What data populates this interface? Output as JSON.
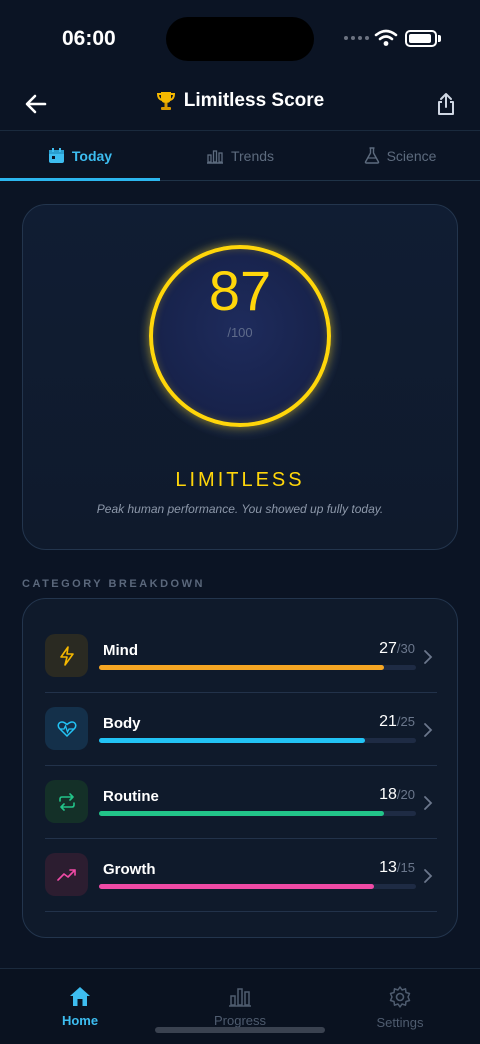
{
  "status": {
    "time": "06:00"
  },
  "header": {
    "title": "Limitless Score",
    "title_icon": "trophy-icon"
  },
  "tabs": [
    {
      "label": "Today",
      "icon": "calendar-icon",
      "active": true
    },
    {
      "label": "Trends",
      "icon": "bar-chart-icon",
      "active": false
    },
    {
      "label": "Science",
      "icon": "flask-icon",
      "active": false
    }
  ],
  "score": {
    "value": "87",
    "max": "/100",
    "progress": 0.87,
    "tier": "LIMITLESS",
    "description": "Peak human performance. You showed up fully today.",
    "accent": "#ffd60a"
  },
  "breakdown": {
    "label": "CATEGORY BREAKDOWN",
    "categories": [
      {
        "name": "Mind",
        "score": "27",
        "max": "/30",
        "fraction": 0.9,
        "color": "#f5a623",
        "icon": "lightning-icon"
      },
      {
        "name": "Body",
        "score": "21",
        "max": "/25",
        "fraction": 0.84,
        "color": "#22c3f5",
        "icon": "heart-pulse-icon"
      },
      {
        "name": "Routine",
        "score": "18",
        "max": "/20",
        "fraction": 0.9,
        "color": "#22c489",
        "icon": "repeat-icon"
      },
      {
        "name": "Growth",
        "score": "13",
        "max": "/15",
        "fraction": 0.867,
        "color": "#f04aa5",
        "icon": "trend-up-icon"
      }
    ]
  },
  "bottom_nav": [
    {
      "label": "Home",
      "icon": "home-icon",
      "active": true
    },
    {
      "label": "Progress",
      "icon": "bar-chart-icon",
      "active": false
    },
    {
      "label": "Settings",
      "icon": "gear-icon",
      "active": false
    }
  ]
}
